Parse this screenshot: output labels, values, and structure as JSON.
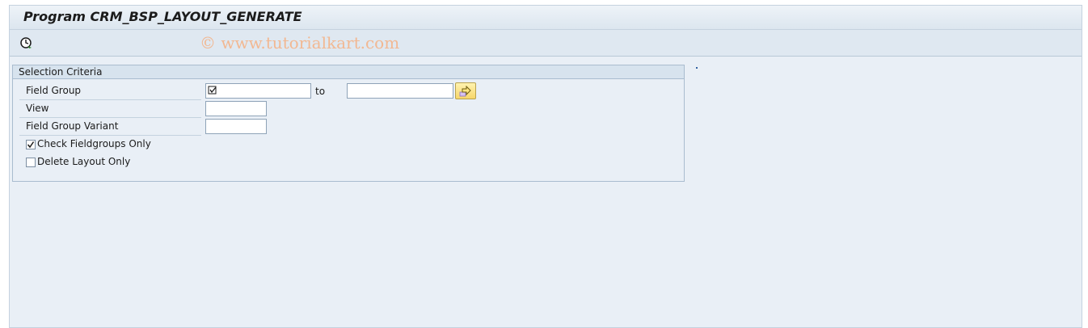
{
  "window": {
    "title": "Program CRM_BSP_LAYOUT_GENERATE"
  },
  "toolbar": {
    "execute_icon": "execute-clock-icon",
    "watermark": "© www.tutorialkart.com"
  },
  "selection": {
    "title": "Selection Criteria",
    "field_group": {
      "label": "Field Group",
      "from_value": "",
      "to_label": "to",
      "to_value": "",
      "selection_icon": "select-option-icon",
      "multiple_selection_icon": "arrow-right-icon"
    },
    "view": {
      "label": "View",
      "value": ""
    },
    "field_group_variant": {
      "label": "Field Group Variant",
      "value": ""
    },
    "check_fieldgroups_only": {
      "label": "Check Fieldgroups Only",
      "checked": true
    },
    "delete_layout_only": {
      "label": "Delete Layout Only",
      "checked": false
    }
  },
  "colors": {
    "background": "#e9eff6",
    "header": "#d7e3ee",
    "watermark": "#f2b892",
    "button": "#f7d66a"
  }
}
